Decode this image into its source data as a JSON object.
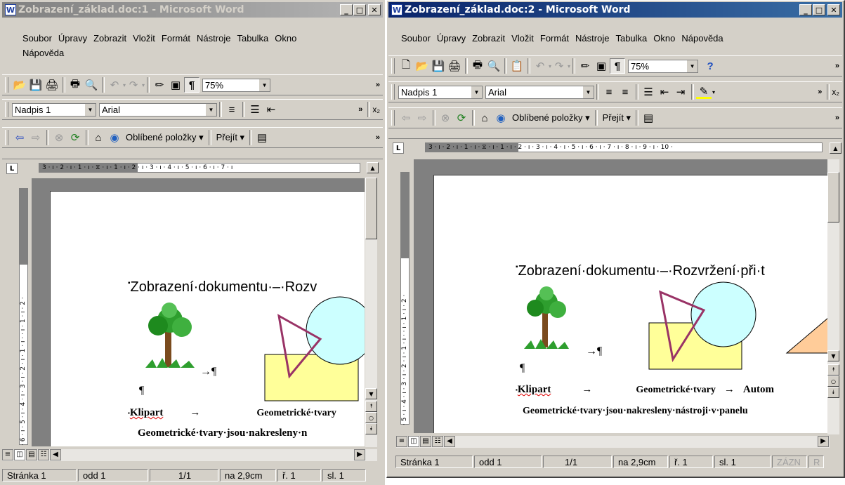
{
  "menu_items": [
    "Soubor",
    "Úpravy",
    "Zobrazit",
    "Vložit",
    "Formát",
    "Nástroje",
    "Tabulka",
    "Okno",
    "Nápověda"
  ],
  "window1": {
    "title": "Zobrazení_základ.doc:1 - Microsoft Word",
    "active": false,
    "zoom": "75%",
    "style": "Nadpis 1",
    "font": "Arial",
    "favorites": "Oblíbené položky",
    "goto": "Přejít",
    "hruler": "3 · ı · 2 · ı · 1 · ı · ⧖ · ı · 1 · ı · 2 · ı · 3 · ı · 4 · ı · 5 · ı · 6 · ı · 7 · ı",
    "vruler": "· 6 · ı · 5 · ı · 4 · ı · 3 · ı · 2 · ı · 1 · ı · · ı · 1 · ı · 2 ·",
    "status": {
      "page": "Stránka 1",
      "section": "odd 1",
      "pages": "1/1",
      "at": "na 2,9cm",
      "line": "ř. 1",
      "col": "sl. 1"
    }
  },
  "window2": {
    "title": "Zobrazení_základ.doc:2 - Microsoft Word",
    "active": true,
    "zoom": "75%",
    "style": "Nadpis 1",
    "font": "Arial",
    "favorites": "Oblíbené položky",
    "goto": "Přejít",
    "hruler": "3 · ı · 2 · ı · 1 · ı · ⧖ · ı · 1 · ı · 2 · ı · 3 · ı · 4 · ı · 5 · ı · 6 · ı · 7 · ı · 8 · ı · 9 · ı · 10 ·",
    "vruler": "· 5 · ı · 4 · ı · 3 · ı · 2 · ı · 1 · ı · · ı · 1 · ı · 2 ·",
    "status": {
      "page": "Stránka 1",
      "section": "odd 1",
      "pages": "1/1",
      "at": "na 2,9cm",
      "line": "ř. 1",
      "col": "sl. 1",
      "rec": "ZÁZN",
      "rev": "R"
    }
  },
  "document": {
    "heading1": "Zobrazení·dokumentu·–·Rozv",
    "heading2": "Zobrazení·dokumentu·–·Rozvržení·při·t",
    "arrow_para": "→¶",
    "pilcrow": "¶",
    "klipart": "Klipart",
    "tab_arrow": "→",
    "geom": "Geometrické·tvary",
    "auto": "Autom",
    "body1": "Geometrické·tvary·jsou·nakresleny·n",
    "body2": "Geometrické·tvary·jsou·nakresleny·nástroji·v·panelu"
  },
  "colors": {
    "title_active": "#0a246a",
    "title_inactive": "#808080",
    "rect_fill": "#ffff99",
    "circle_fill": "#ccffff",
    "triangle_stroke": "#993366",
    "tri_fill": "#ffcc99"
  }
}
